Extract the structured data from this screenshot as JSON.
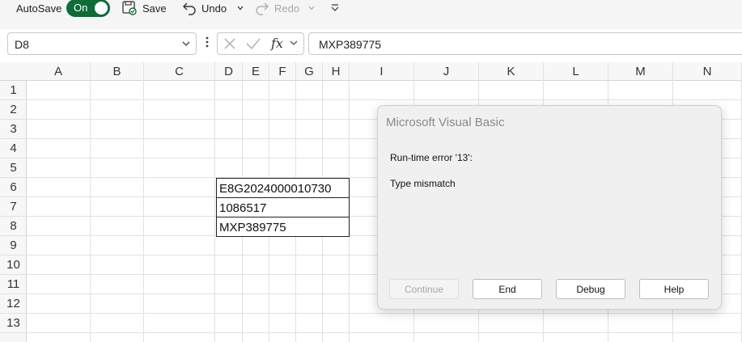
{
  "toolbar": {
    "autosave_label": "AutoSave",
    "autosave_state": "On",
    "save_label": "Save",
    "undo_label": "Undo",
    "redo_label": "Redo"
  },
  "formula_bar": {
    "name_box": "D8",
    "fx_label": "fx",
    "formula_value": "MXP389775"
  },
  "columns": [
    "A",
    "B",
    "C",
    "D",
    "E",
    "F",
    "G",
    "H",
    "I",
    "J",
    "K",
    "L",
    "M",
    "N"
  ],
  "rows": [
    "1",
    "2",
    "3",
    "4",
    "5",
    "6",
    "7",
    "8",
    "9",
    "10",
    "11",
    "12",
    "13"
  ],
  "cells": {
    "D6": "E8G2024000010730",
    "D7": "1086517",
    "D8": "MXP389775"
  },
  "dialog": {
    "title": "Microsoft Visual Basic",
    "error_line": "Run-time error '13':",
    "error_detail": "Type mismatch",
    "buttons": {
      "continue": "Continue",
      "end": "End",
      "debug": "Debug",
      "help": "Help"
    }
  },
  "colors": {
    "toggle_on": "#0f6b38",
    "header_bg": "#f7f7f7",
    "gridline": "#e1e1e1"
  }
}
